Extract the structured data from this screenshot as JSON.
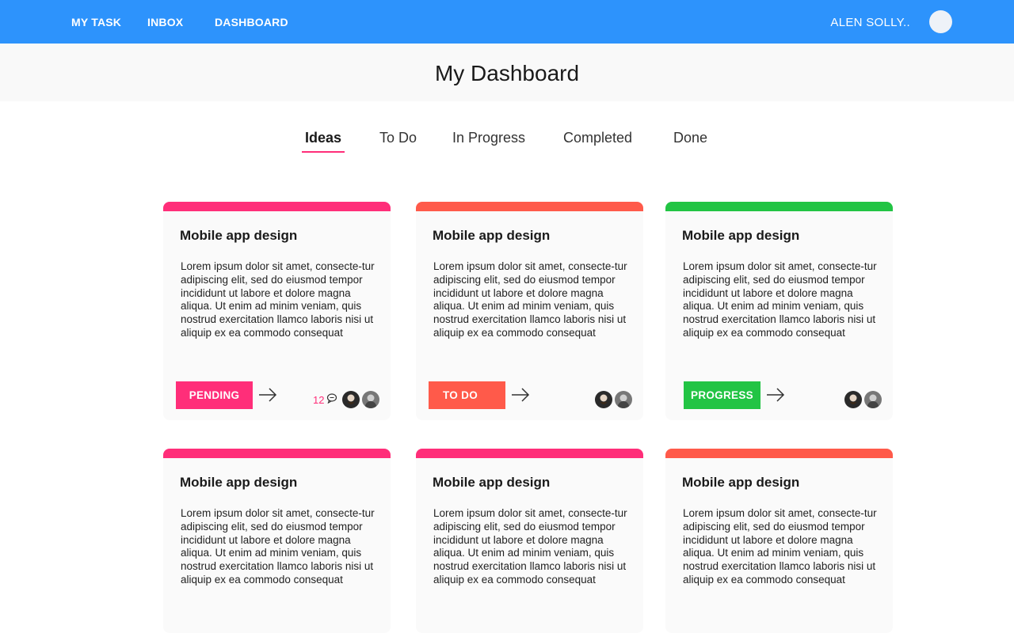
{
  "nav": {
    "links": [
      "MY TASK",
      "INBOX",
      "DASHBOARD"
    ],
    "user_name": "ALEN SOLLY.."
  },
  "page": {
    "title": "My Dashboard"
  },
  "tabs": [
    {
      "label": "Ideas",
      "active": true
    },
    {
      "label": "To Do",
      "active": false
    },
    {
      "label": "In Progress",
      "active": false
    },
    {
      "label": "Completed",
      "active": false
    },
    {
      "label": "Done",
      "active": false
    }
  ],
  "colors": {
    "nav_bg": "#2d93fc",
    "pink": "#ff2e79",
    "coral": "#ff5a4a",
    "green": "#22c444"
  },
  "cards": [
    {
      "title": "Mobile app design",
      "description": "Lorem ipsum dolor sit amet, consecte-tur adipiscing elit, sed do eiusmod tempor incididunt ut labore et dolore magna aliqua. Ut enim ad minim veniam, quis nostrud exercitation llamco laboris nisi ut aliquip ex ea commodo consequat",
      "status": "PENDING",
      "accent": "#ff2e79",
      "comments": "12",
      "arrow_icon": "arrow-right-icon"
    },
    {
      "title": "Mobile app design",
      "description": "Lorem ipsum dolor sit amet, consecte-tur adipiscing elit, sed do eiusmod tempor incididunt ut labore et dolore magna aliqua. Ut enim ad minim veniam, quis nostrud exercitation llamco laboris nisi ut aliquip ex ea commodo consequat",
      "status": "TO DO",
      "accent": "#ff5a4a",
      "arrow_icon": "arrow-right-icon"
    },
    {
      "title": "Mobile app design",
      "description": "Lorem ipsum dolor sit amet, consecte-tur adipiscing elit, sed do eiusmod tempor incididunt ut labore et dolore magna aliqua. Ut enim ad minim veniam, quis nostrud exercitation llamco laboris nisi ut aliquip ex ea commodo consequat",
      "status": "PROGRESS",
      "accent": "#22c444",
      "arrow_icon": "arrow-right-icon"
    },
    {
      "title": "Mobile app design",
      "description": "Lorem ipsum dolor sit amet, consecte-tur adipiscing elit, sed do eiusmod tempor incididunt ut labore et dolore magna aliqua. Ut enim ad minim veniam, quis nostrud exercitation llamco laboris nisi ut aliquip ex ea commodo consequat",
      "accent": "#ff2e79"
    },
    {
      "title": "Mobile app design",
      "description": "Lorem ipsum dolor sit amet, consecte-tur adipiscing elit, sed do eiusmod tempor incididunt ut labore et dolore magna aliqua. Ut enim ad minim veniam, quis nostrud exercitation llamco laboris nisi ut aliquip ex ea commodo consequat",
      "accent": "#ff2e79"
    },
    {
      "title": "Mobile app design",
      "description": "Lorem ipsum dolor sit amet, consecte-tur adipiscing elit, sed do eiusmod tempor incididunt ut labore et dolore magna aliqua. Ut enim ad minim veniam, quis nostrud exercitation llamco laboris nisi ut aliquip ex ea commodo consequat",
      "accent": "#ff5a4a"
    }
  ]
}
